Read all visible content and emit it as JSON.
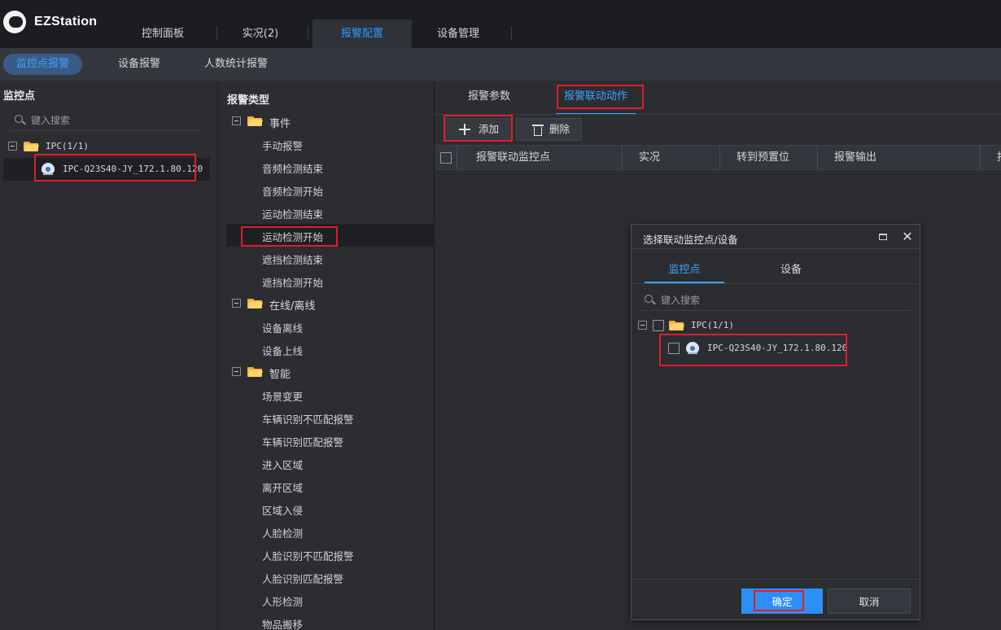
{
  "app": {
    "brand": "EZStation"
  },
  "nav": {
    "tabs": [
      {
        "label": "控制面板"
      },
      {
        "label": "实况(2)"
      },
      {
        "label": "报警配置"
      },
      {
        "label": "设备管理"
      }
    ],
    "active_index": 2
  },
  "subnav": {
    "tabs": [
      {
        "label": "监控点报警"
      },
      {
        "label": "设备报警"
      },
      {
        "label": "人数统计报警"
      }
    ],
    "active_index": 0
  },
  "left": {
    "title": "监控点",
    "search_placeholder": "键入搜索",
    "group": "IPC(1/1)",
    "device": "IPC-Q23S40-JY_172.1.80.120"
  },
  "middle": {
    "title": "报警类型",
    "categories": [
      {
        "label": "事件",
        "items": [
          "手动报警",
          "音频检测结束",
          "音频检测开始",
          "运动检测结束",
          "运动检测开始",
          "遮挡检测结束",
          "遮挡检测开始"
        ]
      },
      {
        "label": "在线/离线",
        "items": [
          "设备离线",
          "设备上线"
        ]
      },
      {
        "label": "智能",
        "items": [
          "场景变更",
          "车辆识别不匹配报警",
          "车辆识别匹配报警",
          "进入区域",
          "离开区域",
          "区域入侵",
          "人脸检测",
          "人脸识别不匹配报警",
          "人脸识别匹配报警",
          "人形检测",
          "物品搬移"
        ]
      }
    ],
    "selected_item": "运动检测开始"
  },
  "right": {
    "tabs": [
      {
        "label": "报警参数"
      },
      {
        "label": "报警联动动作"
      }
    ],
    "active_index": 1,
    "toolbar": {
      "add": "添加",
      "delete": "删除"
    },
    "columns": [
      "报警联动监控点",
      "实况",
      "转到预置位",
      "报警输出",
      "报"
    ]
  },
  "dialog": {
    "title": "选择联动监控点/设备",
    "tabs": [
      {
        "label": "监控点"
      },
      {
        "label": "设备"
      }
    ],
    "active_index": 0,
    "search_placeholder": "键入搜索",
    "group": "IPC(1/1)",
    "device": "IPC-Q23S40-JY_172.1.80.120",
    "ok": "确定",
    "cancel": "取消"
  },
  "colors": {
    "accent": "#3ea2ff",
    "primary_button": "#2c8ff5",
    "highlight_box": "#e11d2a",
    "topbar": "#1c1d20",
    "panel": "#2b2d31"
  }
}
